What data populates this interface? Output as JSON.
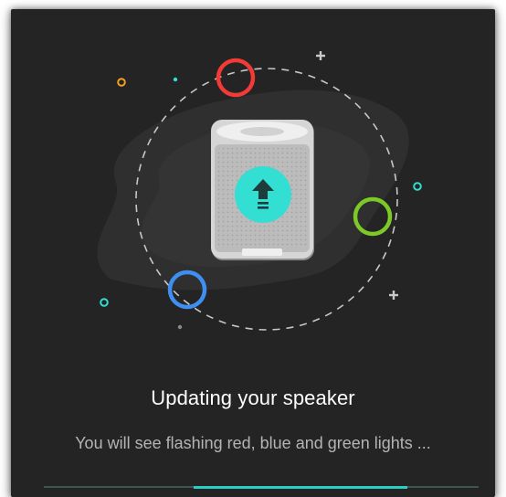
{
  "dialog": {
    "title": "Updating your speaker",
    "message": "You will see flashing red, blue and green lights ..."
  },
  "progress": {
    "indeterminate": true,
    "color": "#2ccdc4"
  },
  "illustration": {
    "icon": "upload-arrow-icon",
    "colors": {
      "red_ring": "#f23a36",
      "green_ring": "#7cc927",
      "blue_ring": "#3f8ef2",
      "accent": "#33ded2",
      "orange_dot": "#f5a01f"
    }
  }
}
